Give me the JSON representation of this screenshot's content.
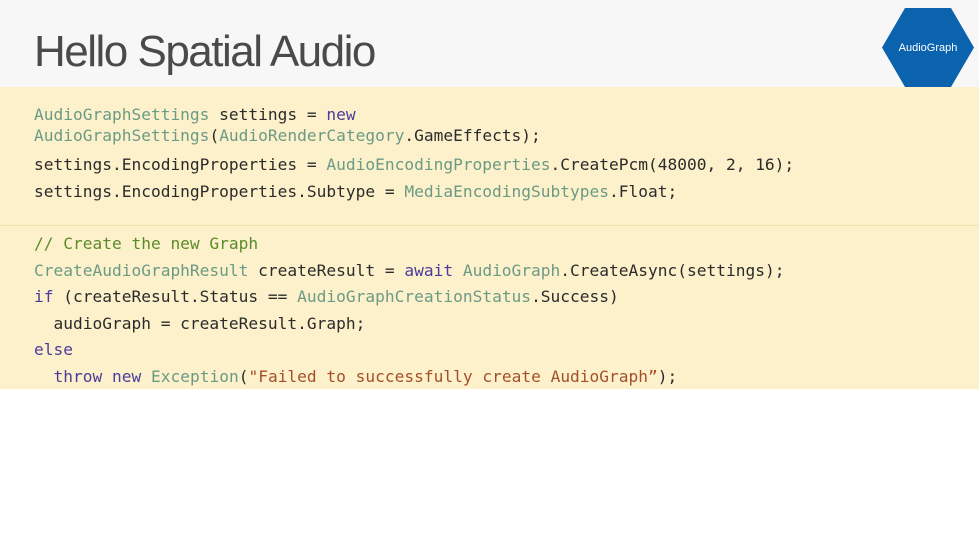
{
  "slide": {
    "title": "Hello Spatial Audio",
    "badge": {
      "label": "AudioGraph",
      "shape": "hexagon",
      "color": "#0b62ad"
    }
  },
  "colors": {
    "header_bg": "#f7f7f7",
    "code_bg": "#fdf1cb",
    "type": "#6b9a85",
    "keyword": "#4a3c9c",
    "comment": "#5b8a2b",
    "string": "#a3502a",
    "plain": "#2b2b2b"
  },
  "code_blocks": [
    {
      "lines": [
        [
          {
            "k": "t",
            "v": "AudioGraphSettings"
          },
          {
            "k": "p",
            "v": " settings = "
          },
          {
            "k": "k",
            "v": "new"
          }
        ],
        [
          {
            "k": "t",
            "v": "AudioGraphSettings"
          },
          {
            "k": "p",
            "v": "("
          },
          {
            "k": "t",
            "v": "AudioRenderCategory"
          },
          {
            "k": "p",
            "v": ".GameEffects);"
          }
        ],
        [
          {
            "k": "p",
            "v": "settings.EncodingProperties = "
          },
          {
            "k": "t",
            "v": "AudioEncodingProperties"
          },
          {
            "k": "p",
            "v": ".CreatePcm(48000, 2, 16);"
          }
        ],
        [
          {
            "k": "p",
            "v": "settings.EncodingProperties.Subtype = "
          },
          {
            "k": "t",
            "v": "MediaEncodingSubtypes"
          },
          {
            "k": "p",
            "v": ".Float;"
          }
        ]
      ]
    },
    {
      "lines": [
        [
          {
            "k": "c",
            "v": "// Create the new Graph"
          }
        ],
        [
          {
            "k": "t",
            "v": "CreateAudioGraphResult"
          },
          {
            "k": "p",
            "v": " createResult = "
          },
          {
            "k": "k",
            "v": "await"
          },
          {
            "k": "p",
            "v": " "
          },
          {
            "k": "t",
            "v": "AudioGraph"
          },
          {
            "k": "p",
            "v": ".CreateAsync(settings);"
          }
        ],
        [
          {
            "k": "k",
            "v": "if"
          },
          {
            "k": "p",
            "v": " (createResult.Status == "
          },
          {
            "k": "t",
            "v": "AudioGraphCreationStatus"
          },
          {
            "k": "p",
            "v": ".Success)"
          }
        ],
        [
          {
            "k": "p",
            "v": "  audioGraph = createResult.Graph;"
          }
        ],
        [
          {
            "k": "k",
            "v": "else"
          }
        ],
        [
          {
            "k": "p",
            "v": "  "
          },
          {
            "k": "k",
            "v": "throw"
          },
          {
            "k": "p",
            "v": " "
          },
          {
            "k": "k",
            "v": "new"
          },
          {
            "k": "p",
            "v": " "
          },
          {
            "k": "t",
            "v": "Exception"
          },
          {
            "k": "p",
            "v": "("
          },
          {
            "k": "s",
            "v": "\"Failed to successfully create AudioGraph”"
          },
          {
            "k": "p",
            "v": ");"
          }
        ]
      ]
    }
  ]
}
